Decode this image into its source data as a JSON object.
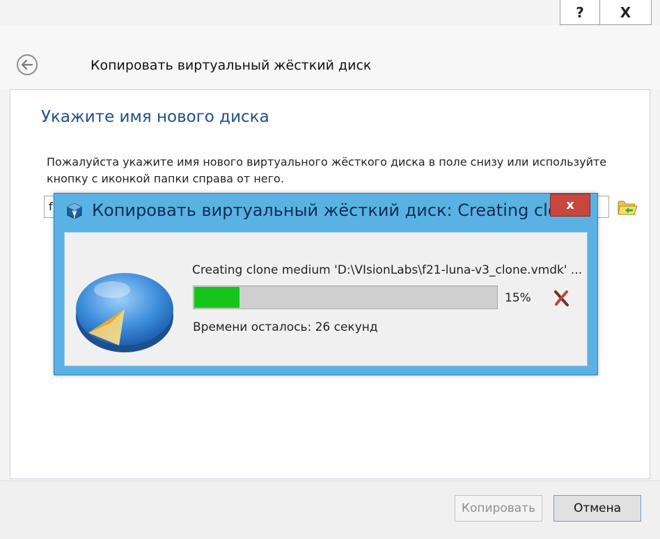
{
  "window": {
    "help_label": "?",
    "close_label": "X"
  },
  "wizard": {
    "title": "Копировать виртуальный жёсткий диск",
    "heading": "Укажите имя нового диска",
    "description": "Пожалуйста укажите имя нового виртуального жёсткого диска в поле снизу или используйте кнопку с иконкой папки справа от него.",
    "filename_value": "f",
    "copy_button": "Копировать",
    "cancel_button": "Отмена"
  },
  "progress_dialog": {
    "title": "Копировать виртуальный жёсткий диск: Creating clo",
    "close_label": "x",
    "operation": "Creating clone medium 'D:\\VIsionLabs\\f21-luna-v3_clone.vmdk' ...",
    "progress": 0.15,
    "percent_text": "15%",
    "time_remaining": "Времени осталось: 26 секунд"
  },
  "colors": {
    "accent_blue": "#5ab2e4",
    "heading_blue": "#1e4f8c",
    "progress_green": "#16c41a",
    "close_red": "#c8463d"
  },
  "icons": {
    "back": "arrow-left-icon",
    "folder": "folder-icon",
    "app": "virtualbox-icon",
    "media": "pie-disk-icon",
    "cancel": "cancel-x-icon"
  }
}
